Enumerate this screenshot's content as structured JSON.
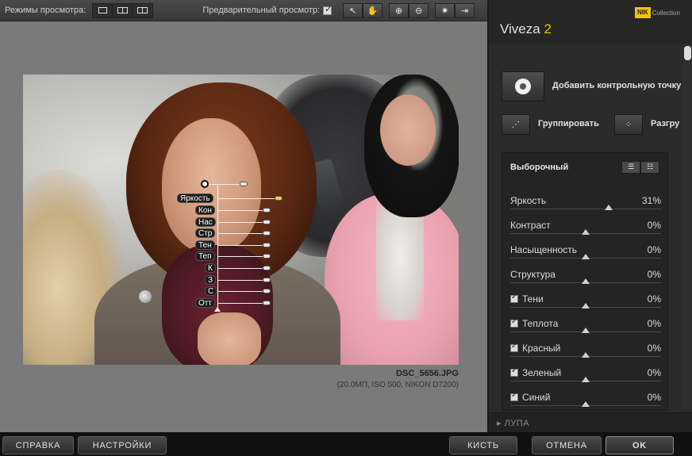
{
  "toolbar": {
    "view_modes_label": "Режимы просмотра:",
    "preview_label": "Предварительный просмотр:",
    "preview_checked": true,
    "tools": [
      "pointer-icon",
      "hand-icon",
      "zoom-in-icon",
      "zoom-out-icon",
      "bulb-icon",
      "export-icon"
    ]
  },
  "image": {
    "filename": "DSC_5656.JPG",
    "info": "(20.0МП, ISO 500, NIKON D7200)",
    "control_point": {
      "labels": [
        "Яркость",
        "Кон",
        "Нас",
        "Стр",
        "Тен",
        "Теп",
        "К",
        "З",
        "С",
        "Отт"
      ]
    }
  },
  "panel": {
    "brand": "NIK",
    "brand_suffix": "Collection",
    "app_name": "Viveza",
    "app_version": "2",
    "add_point_label": "Добавить контрольную точку",
    "group_label": "Группировать",
    "ungroup_label": "Разгру",
    "section_title": "Выборочный",
    "sliders": [
      {
        "label": "Яркость",
        "value": "31%",
        "checkbox": false,
        "level": 0.31
      },
      {
        "label": "Контраст",
        "value": "0%",
        "checkbox": false,
        "level": 0
      },
      {
        "label": "Насыщенность",
        "value": "0%",
        "checkbox": false,
        "level": 0
      },
      {
        "label": "Структура",
        "value": "0%",
        "checkbox": false,
        "level": 0
      },
      {
        "label": "Тени",
        "value": "0%",
        "checkbox": true,
        "level": 0
      },
      {
        "label": "Теплота",
        "value": "0%",
        "checkbox": true,
        "level": 0
      },
      {
        "label": "Красный",
        "value": "0%",
        "checkbox": true,
        "level": 0
      },
      {
        "label": "Зеленый",
        "value": "0%",
        "checkbox": true,
        "level": 0
      },
      {
        "label": "Синий",
        "value": "0%",
        "checkbox": true,
        "level": 0
      }
    ],
    "loupe_label": "▸ ЛУПА"
  },
  "bottom": {
    "help": "СПРАВКА",
    "settings": "НАСТРОЙКИ",
    "brush": "КИСТЬ",
    "cancel": "ОТМЕНА",
    "ok": "OK"
  },
  "colors": {
    "accent": "#f0c300"
  }
}
